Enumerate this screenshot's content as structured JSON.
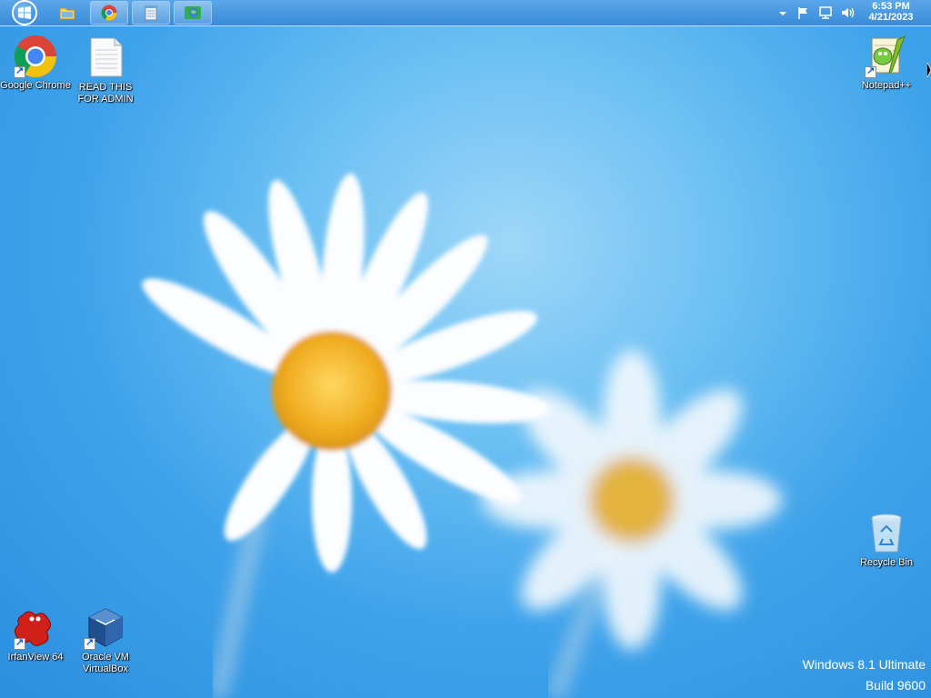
{
  "taskbar": {
    "start_button_icon": "windows-logo-icon",
    "items": [
      {
        "name": "file-explorer",
        "icon": "folder-icon"
      },
      {
        "name": "google-chrome",
        "icon": "chrome-icon"
      },
      {
        "name": "notepad",
        "icon": "notepad-icon"
      },
      {
        "name": "network-app",
        "icon": "globe-icon"
      }
    ],
    "tray_icons": [
      "chevron-up-icon",
      "flag-icon",
      "network-icon",
      "volume-icon"
    ],
    "clock": {
      "time": "6:53 PM",
      "date": "4/21/2023"
    }
  },
  "desktop": {
    "icons": [
      {
        "label": "Google Chrome",
        "icon": "chrome-icon"
      },
      {
        "label": "READ THIS FOR ADMIN",
        "icon": "text-file-icon"
      },
      {
        "label": "Notepad++",
        "icon": "notepadpp-icon"
      },
      {
        "label": "Recycle Bin",
        "icon": "recycle-bin-icon"
      },
      {
        "label": "IrfanView 64",
        "icon": "irfanview-icon"
      },
      {
        "label": "Oracle VM VirtualBox",
        "icon": "virtualbox-icon"
      }
    ]
  },
  "watermark": {
    "line1": "Windows 8.1 Ultimate",
    "line2": "Build 9600"
  },
  "colors": {
    "desktop_bg": "#3fa3ea",
    "taskbar": "#3b8ad8",
    "flower_center": "#f2b42a"
  }
}
